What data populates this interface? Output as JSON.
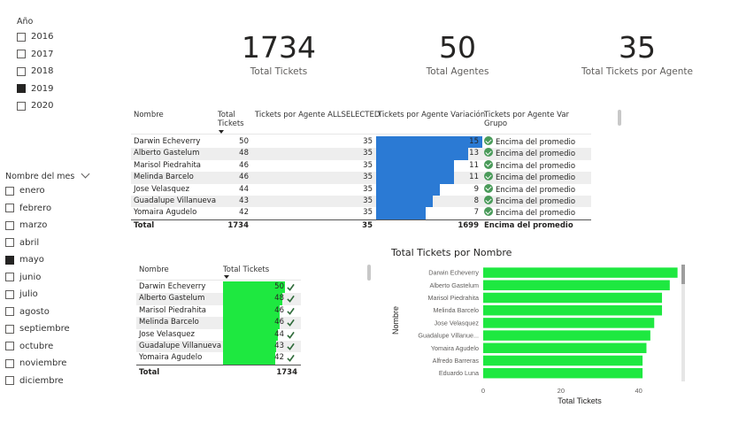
{
  "slicer_year": {
    "title": "Año",
    "items": [
      {
        "label": "2016",
        "checked": false
      },
      {
        "label": "2017",
        "checked": false
      },
      {
        "label": "2018",
        "checked": false
      },
      {
        "label": "2019",
        "checked": true
      },
      {
        "label": "2020",
        "checked": false
      }
    ]
  },
  "slicer_month": {
    "title": "Nombre del mes",
    "items": [
      {
        "label": "enero",
        "checked": false
      },
      {
        "label": "febrero",
        "checked": false
      },
      {
        "label": "marzo",
        "checked": false
      },
      {
        "label": "abril",
        "checked": false
      },
      {
        "label": "mayo",
        "checked": true
      },
      {
        "label": "junio",
        "checked": false
      },
      {
        "label": "julio",
        "checked": false
      },
      {
        "label": "agosto",
        "checked": false
      },
      {
        "label": "septiembre",
        "checked": false
      },
      {
        "label": "octubre",
        "checked": false
      },
      {
        "label": "noviembre",
        "checked": false
      },
      {
        "label": "diciembre",
        "checked": false
      }
    ]
  },
  "kpis": [
    {
      "value": "1734",
      "label": "Total Tickets"
    },
    {
      "value": "50",
      "label": "Total Agentes"
    },
    {
      "value": "35",
      "label": "Total Tickets por Agente"
    }
  ],
  "table1": {
    "headers": [
      "Nombre",
      "Total Tickets",
      "Tickets por Agente ALLSELECTED",
      "Tickets por Agente Variación",
      "Tickets por Agente Var Grupo"
    ],
    "rows": [
      {
        "nombre": "Darwin Echeverry",
        "total": "50",
        "allselected": "35",
        "variacion": "15",
        "grupo": "Encima del promedio"
      },
      {
        "nombre": "Alberto Gastelum",
        "total": "48",
        "allselected": "35",
        "variacion": "13",
        "grupo": "Encima del promedio"
      },
      {
        "nombre": "Marisol Piedrahita",
        "total": "46",
        "allselected": "35",
        "variacion": "11",
        "grupo": "Encima del promedio"
      },
      {
        "nombre": "Melinda Barcelo",
        "total": "46",
        "allselected": "35",
        "variacion": "11",
        "grupo": "Encima del promedio"
      },
      {
        "nombre": "Jose Velasquez",
        "total": "44",
        "allselected": "35",
        "variacion": "9",
        "grupo": "Encima del promedio"
      },
      {
        "nombre": "Guadalupe Villanueva",
        "total": "43",
        "allselected": "35",
        "variacion": "8",
        "grupo": "Encima del promedio"
      },
      {
        "nombre": "Yomaira Agudelo",
        "total": "42",
        "allselected": "35",
        "variacion": "7",
        "grupo": "Encima del promedio"
      }
    ],
    "total_row": {
      "label": "Total",
      "total": "1734",
      "allselected": "35",
      "variacion": "1699",
      "grupo": "Encima del promedio"
    }
  },
  "table2": {
    "headers": [
      "Nombre",
      "Total Tickets"
    ],
    "rows": [
      {
        "nombre": "Darwin Echeverry",
        "total": "50"
      },
      {
        "nombre": "Alberto Gastelum",
        "total": "48"
      },
      {
        "nombre": "Marisol Piedrahita",
        "total": "46"
      },
      {
        "nombre": "Melinda Barcelo",
        "total": "46"
      },
      {
        "nombre": "Jose Velasquez",
        "total": "44"
      },
      {
        "nombre": "Guadalupe Villanueva",
        "total": "43"
      },
      {
        "nombre": "Yomaira Agudelo",
        "total": "42"
      }
    ],
    "total_row": {
      "label": "Total",
      "total": "1734"
    }
  },
  "colors": {
    "accent_blue": "#2b7ad4",
    "accent_green": "#1ee840",
    "check_green": "#4a9b5a"
  },
  "chart_data": {
    "type": "bar",
    "orientation": "horizontal",
    "title": "Total Tickets por Nombre",
    "xlabel": "Total Tickets",
    "ylabel": "Nombre",
    "categories": [
      "Darwin Echeverry",
      "Alberto Gastelum",
      "Marisol Piedrahita",
      "Melinda Barcelo",
      "Jose Velasquez",
      "Guadalupe Villanue...",
      "Yomaira Agudelo",
      "Alfredo Barreras",
      "Eduardo Luna"
    ],
    "values": [
      50,
      48,
      46,
      46,
      44,
      43,
      42,
      41,
      41
    ],
    "xticks": [
      "0",
      "20",
      "40"
    ],
    "xlim": [
      0,
      51
    ],
    "grid": false,
    "color": "#1ee840"
  }
}
